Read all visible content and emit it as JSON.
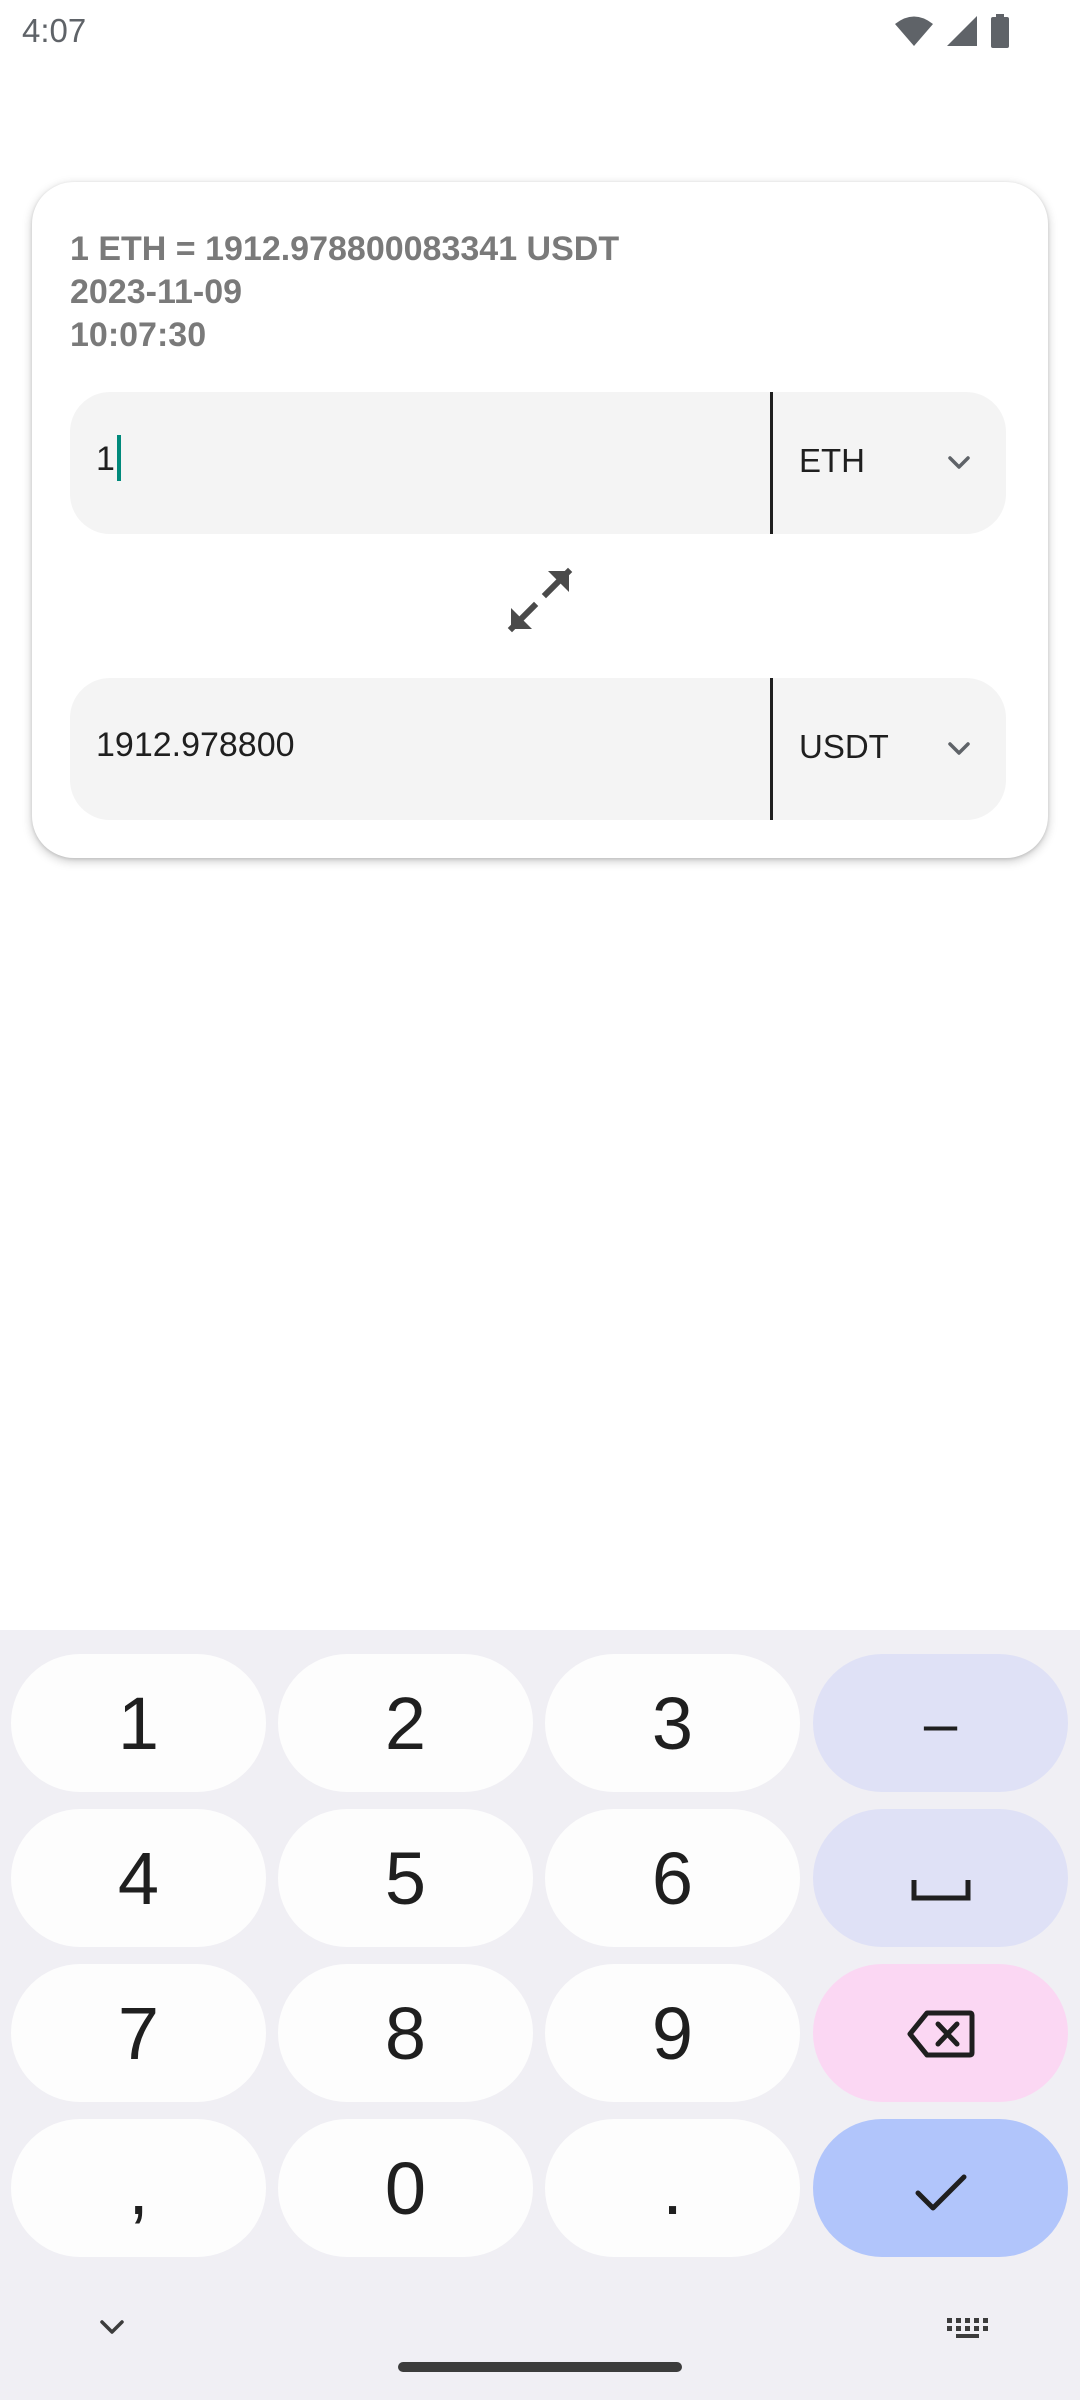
{
  "status_bar": {
    "time": "4:07",
    "icons": [
      "wifi-icon",
      "signal-icon",
      "battery-icon"
    ]
  },
  "rate_info": {
    "rate_line": "1 ETH = 1912.978800083341 USDT",
    "date": "2023-11-09",
    "time": "10:07:30"
  },
  "from": {
    "amount": "1",
    "currency": "ETH"
  },
  "to": {
    "amount": "1912.978800",
    "currency": "USDT"
  },
  "keyboard": {
    "keys": {
      "k1": "1",
      "k2": "2",
      "k3": "3",
      "minus": "–",
      "k4": "4",
      "k5": "5",
      "k6": "6",
      "k7": "7",
      "k8": "8",
      "k9": "9",
      "comma": ",",
      "k0": "0",
      "period": "."
    },
    "colors": {
      "background": "#f0eff4",
      "key": "#fdfdfd",
      "function_key": "#dfe1f6",
      "delete_key": "#fbd7f3",
      "enter_key": "#b1c5fb"
    }
  },
  "colors": {
    "caret": "#00897b",
    "field_background": "#f4f4f4",
    "rate_text": "#7a7a7a"
  }
}
